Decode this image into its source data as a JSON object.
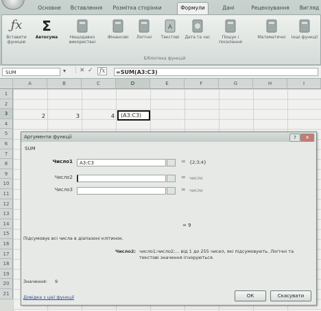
{
  "ribbon": {
    "tabs": [
      "Основне",
      "Вставлення",
      "Розмітка сторінки",
      "Формули",
      "Дані",
      "Рецензування",
      "Вигляд"
    ],
    "active_tab": "Формули",
    "buttons": [
      {
        "label": "Вставити функцію",
        "icon": "fx-icon"
      },
      {
        "label": "Автосума",
        "icon": "sigma-icon"
      },
      {
        "label": "Нещодавно використані",
        "icon": "book-icon"
      },
      {
        "label": "Фінансові",
        "icon": "book-icon"
      },
      {
        "label": "Логічні",
        "icon": "book-icon"
      },
      {
        "label": "Текстові",
        "icon": "book-icon"
      },
      {
        "label": "Дата та час",
        "icon": "book-icon"
      },
      {
        "label": "Пошук і посилання",
        "icon": "book-icon"
      },
      {
        "label": "Математичні",
        "icon": "book-icon"
      },
      {
        "label": "Інші функції",
        "icon": "book-icon"
      }
    ],
    "group_label": "Бібліотека функцій"
  },
  "formula_bar": {
    "name_box": "SUM",
    "formula": "=SUM(A3:C3)"
  },
  "grid": {
    "columns": [
      "A",
      "B",
      "C",
      "D",
      "E",
      "F",
      "G",
      "H",
      "I"
    ],
    "selected_column": "D",
    "rows": [
      "1",
      "2",
      "3",
      "4",
      "5",
      "6",
      "7",
      "8",
      "9",
      "10",
      "11",
      "12",
      "13",
      "14",
      "15",
      "16",
      "17",
      "18",
      "19",
      "20",
      "21"
    ],
    "cells": {
      "A3": "2",
      "B3": "3",
      "C3": "4",
      "D3": "(A3:C3)"
    }
  },
  "dialog": {
    "title": "Аргументи функції",
    "function_name": "SUM",
    "args": [
      {
        "label": "Число1",
        "value": "A3:C3",
        "result": "{2;3;4}"
      },
      {
        "label": "Число2",
        "value": "",
        "result": "число"
      },
      {
        "label": "Число3",
        "value": "",
        "result": "число"
      }
    ],
    "result_line": "= 9",
    "description": "Підсумовує всі числа в діапазоні клітинок.",
    "arg_name": "Число2:",
    "arg_description": "число1;число2;... від 1 до 255 чисел, які підсумовують. Логічні та текстові значення ігноруються.",
    "value_label": "Значення:",
    "value": "9",
    "help_link": "Довідка з цієї функції",
    "ok_label": "ОК",
    "cancel_label": "Скасувати"
  }
}
